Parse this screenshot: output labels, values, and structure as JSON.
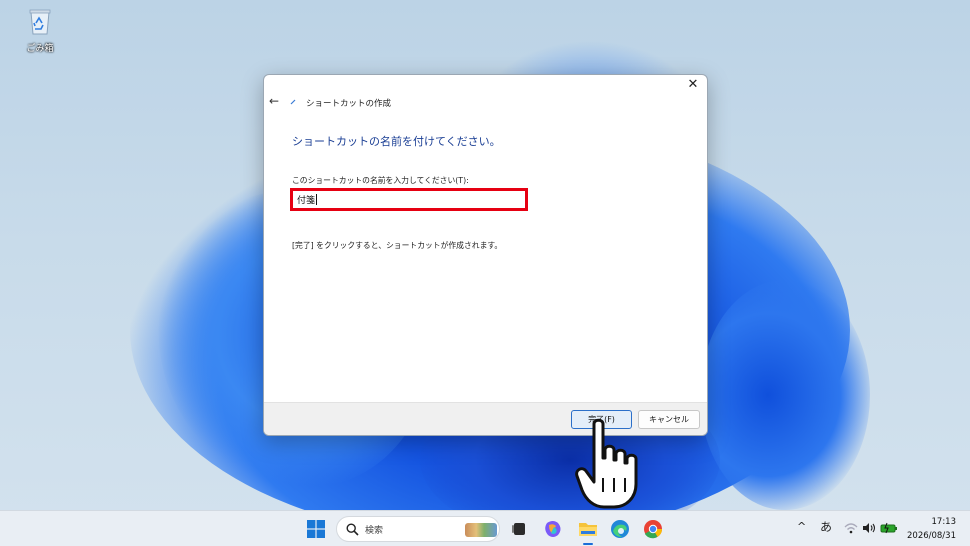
{
  "desktop": {
    "recycle_bin_label": "ごみ箱"
  },
  "dialog": {
    "title": "ショートカットの作成",
    "heading": "ショートカットの名前を付けてください。",
    "field_label": "このショートカットの名前を入力してください(T):",
    "field_value": "付箋",
    "info_text": "[完了] をクリックすると、ショートカットが作成されます。",
    "finish_label": "完了(F)",
    "cancel_label": "キャンセル",
    "close_glyph": "✕",
    "back_glyph": "←"
  },
  "taskbar": {
    "search_placeholder": "検索",
    "tray_ime": "あ",
    "tray_chevron": "^",
    "time": "17:13",
    "date": "2026/08/31"
  },
  "icons": [
    "recycle-bin-icon",
    "back-arrow-icon",
    "close-icon",
    "windows-start-icon",
    "search-icon",
    "task-view-icon",
    "copilot-icon",
    "file-explorer-icon",
    "edge-icon",
    "chrome-icon",
    "wifi-icon",
    "volume-icon",
    "battery-icon",
    "hand-pointer-icon"
  ],
  "colors": {
    "heading_blue": "#1a3e94",
    "highlight_red": "#e60012",
    "finish_button_border": "#2b6fc9"
  }
}
